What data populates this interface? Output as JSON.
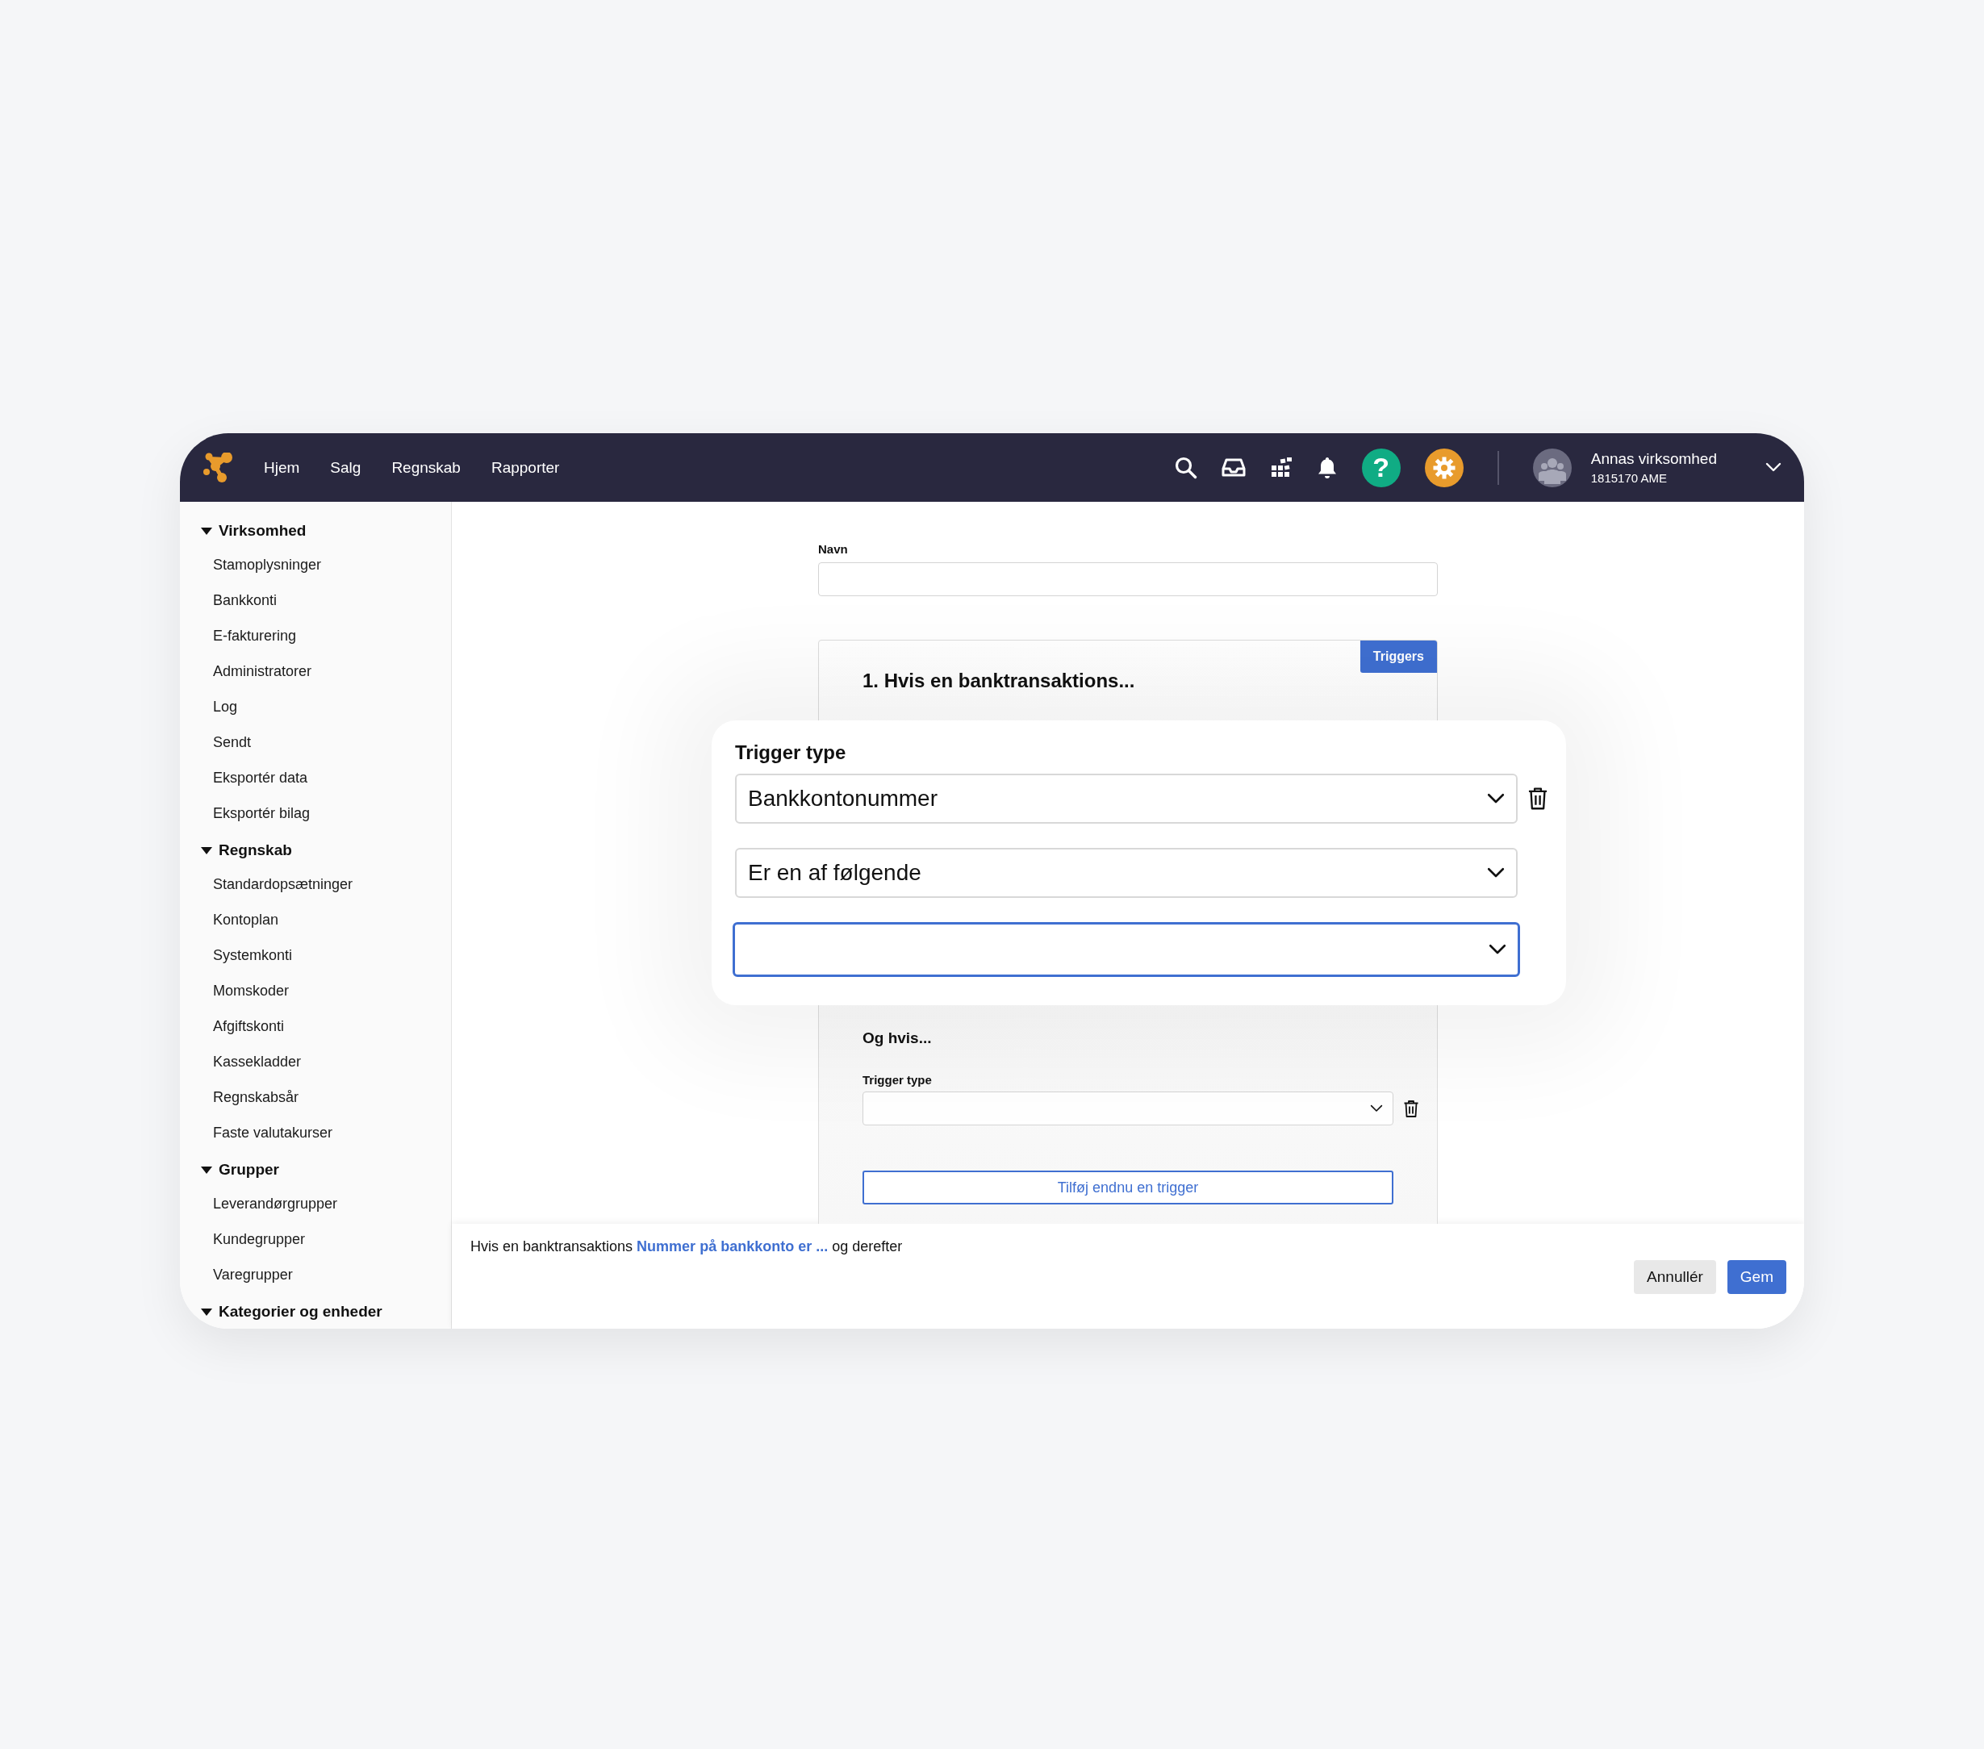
{
  "topbar": {
    "nav": [
      {
        "label": "Hjem"
      },
      {
        "label": "Salg"
      },
      {
        "label": "Regnskab"
      },
      {
        "label": "Rapporter"
      }
    ],
    "help": "?",
    "account": {
      "name": "Annas virksomhed",
      "id": "1815170 AME"
    }
  },
  "sidebar": {
    "sections": [
      {
        "title": "Virksomhed",
        "expanded": true,
        "items": [
          "Stamoplysninger",
          "Bankkonti",
          "E-fakturering",
          "Administratorer",
          "Log",
          "Sendt",
          "Eksportér data",
          "Eksportér bilag"
        ]
      },
      {
        "title": "Regnskab",
        "expanded": true,
        "items": [
          "Standardopsætninger",
          "Kontoplan",
          "Systemkonti",
          "Momskoder",
          "Afgiftskonti",
          "Kassekladder",
          "Regnskabsår",
          "Faste valutakurser"
        ]
      },
      {
        "title": "Grupper",
        "expanded": true,
        "items": [
          "Leverandørgrupper",
          "Kundegrupper",
          "Varegrupper"
        ]
      },
      {
        "title": "Kategorier og enheder",
        "expanded": true
      }
    ]
  },
  "form": {
    "name_label": "Navn",
    "card": {
      "badge": "Triggers",
      "heading": "1. Hvis en banktransaktions...",
      "popover": {
        "label": "Trigger type",
        "selects": [
          {
            "value": "Bankkontonummer",
            "focused": false,
            "deletable": true
          },
          {
            "value": "Er en af følgende",
            "focused": false,
            "deletable": false
          },
          {
            "focused": true,
            "deletable": false
          }
        ]
      },
      "and_heading": "Og hvis...",
      "and_label": "Trigger type",
      "add_button": "Tilføj endnu en trigger"
    }
  },
  "summary": {
    "prefix": "Hvis en banktransaktions",
    "link": "Nummer på bankkonto er ...",
    "suffix": "og derefter"
  },
  "buttons": [
    {
      "label": "Annullér",
      "kind": "secondary"
    },
    {
      "label": "Gem",
      "kind": "primary"
    }
  ]
}
